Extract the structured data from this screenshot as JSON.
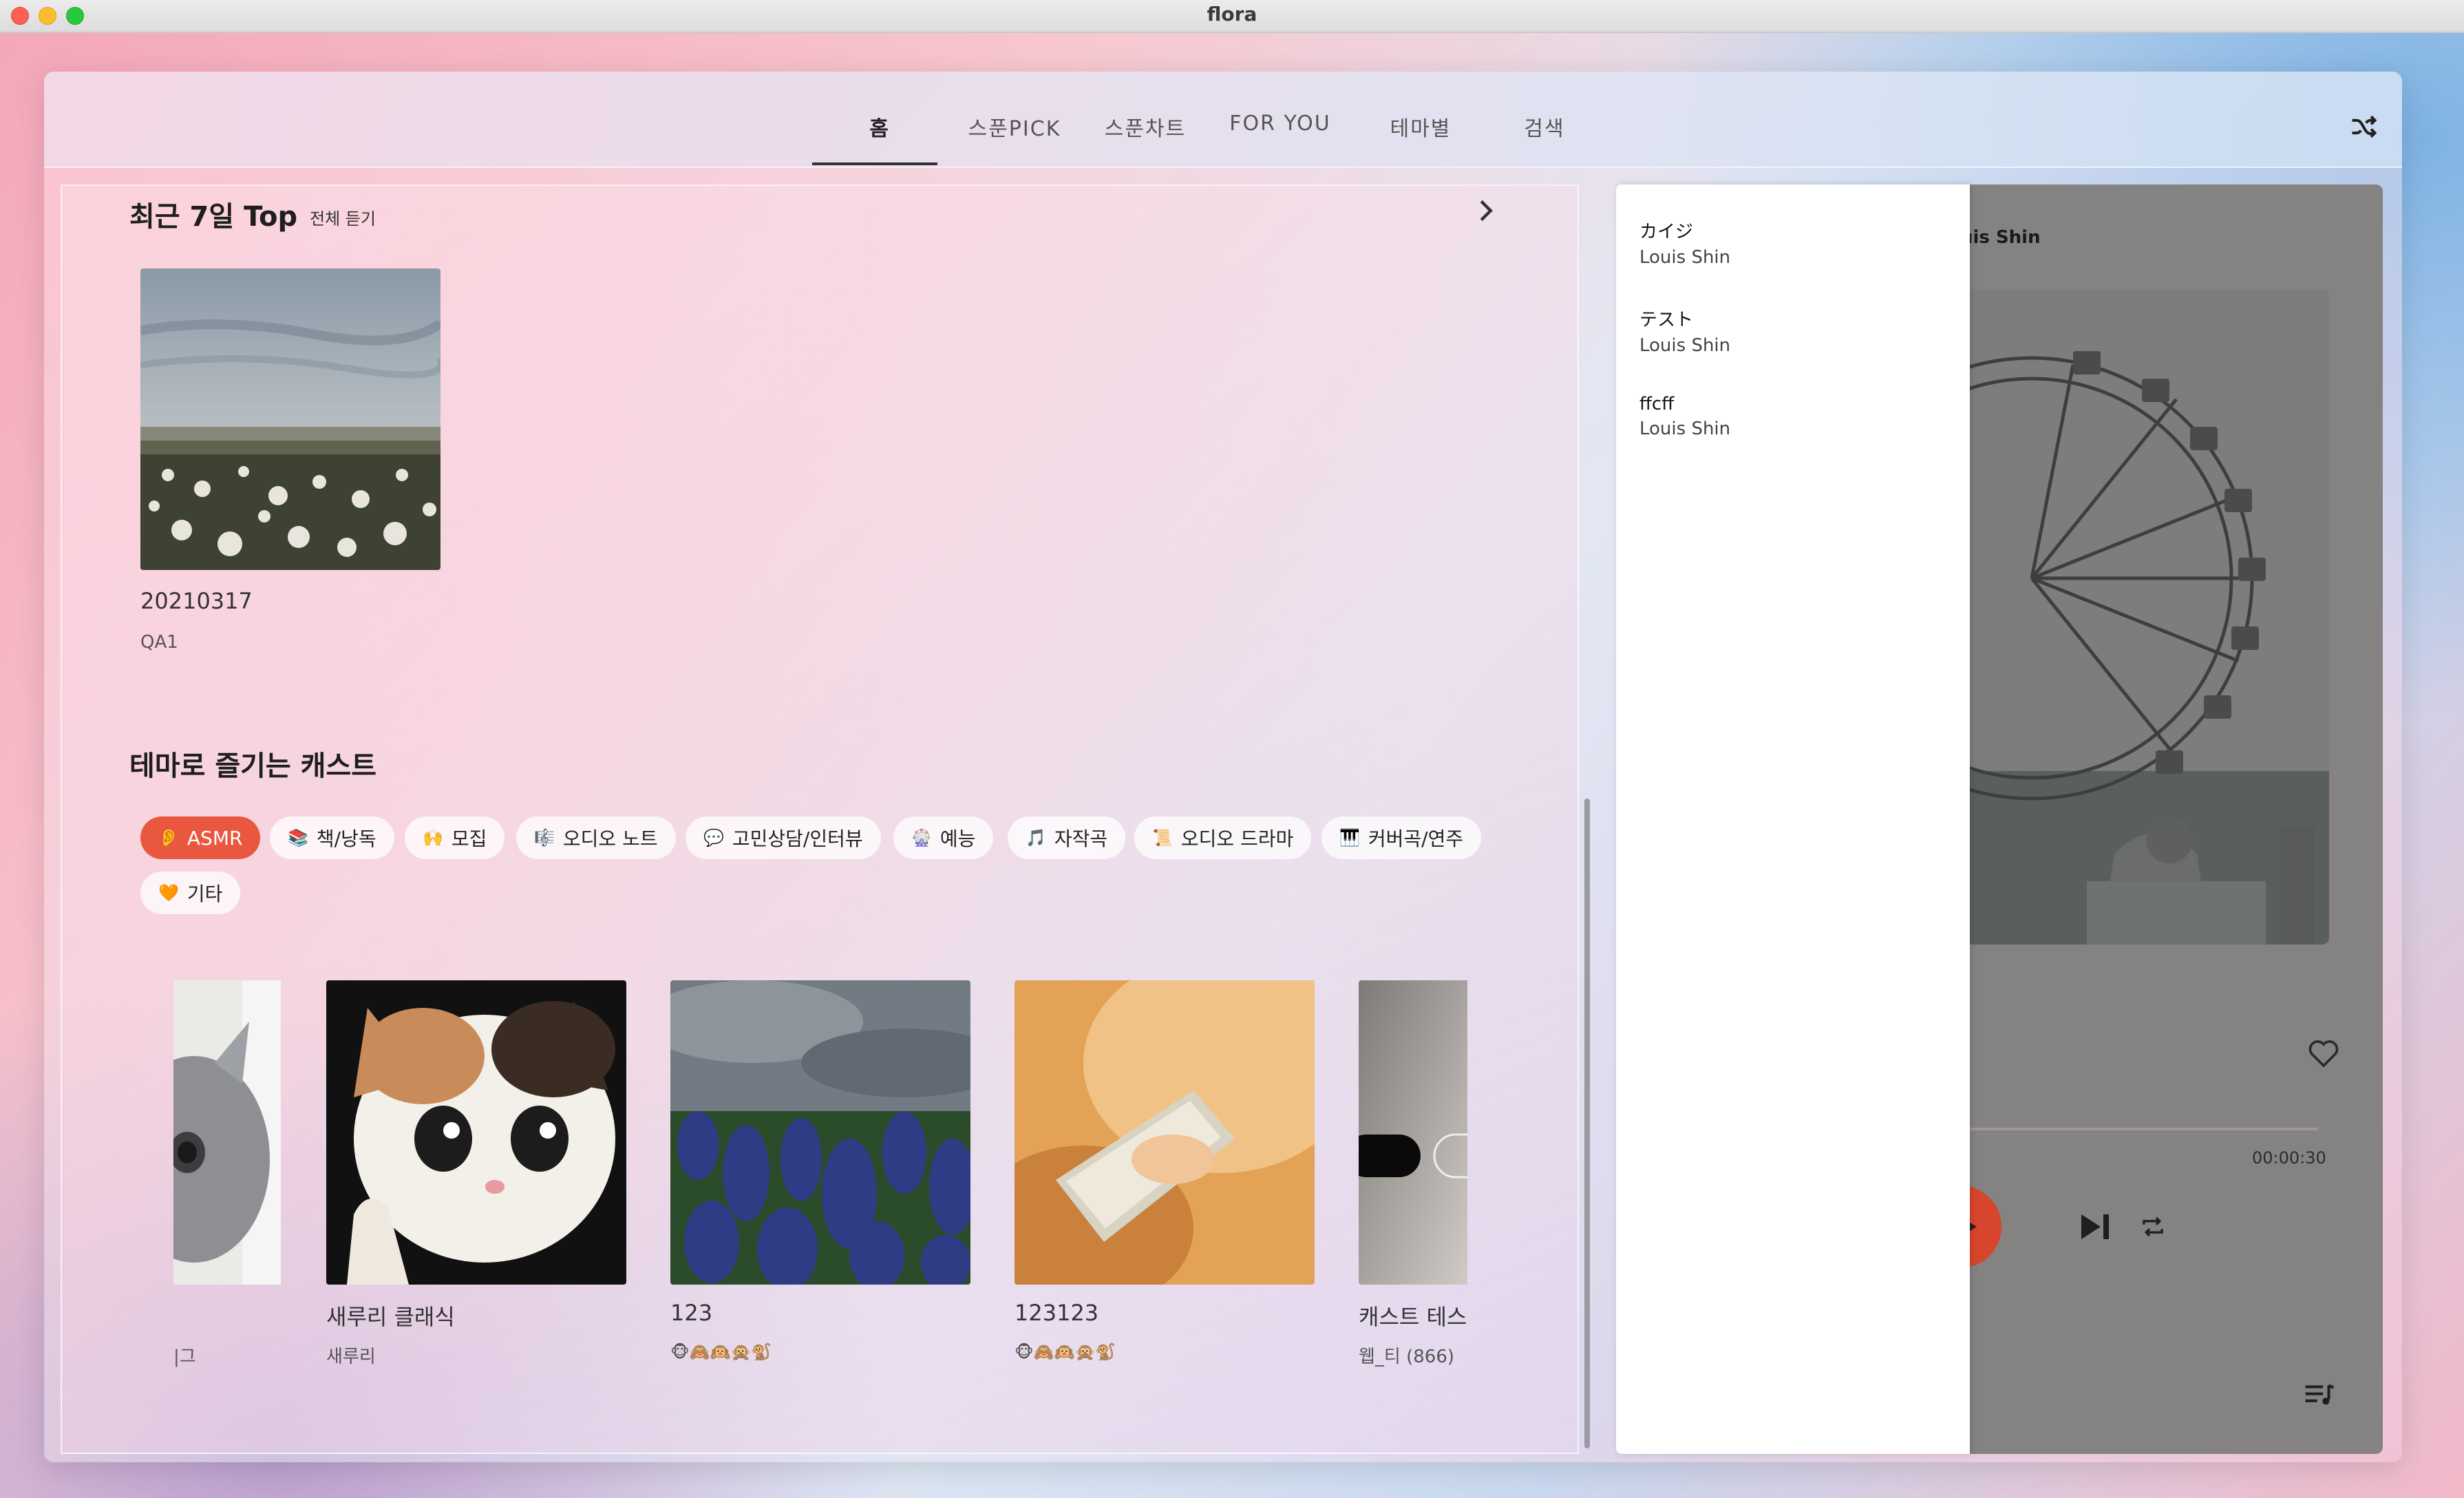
{
  "window": {
    "title": "flora"
  },
  "nav": {
    "tabs": [
      {
        "label": "홈",
        "active": true
      },
      {
        "label": "스푼PICK",
        "active": false
      },
      {
        "label": "스푼차트",
        "active": false
      },
      {
        "label": "FOR YOU",
        "active": false
      },
      {
        "label": "테마별",
        "active": false
      },
      {
        "label": "검색",
        "active": false
      }
    ],
    "shuffle_icon": "shuffle-icon"
  },
  "recent_top": {
    "title": "최근 7일 Top",
    "play_all": "전체 듣기",
    "items": [
      {
        "title": "20210317",
        "subtitle": "QA1"
      }
    ]
  },
  "themes": {
    "title": "테마로 즐기는 캐스트",
    "chips": [
      {
        "emoji": "👂",
        "label": "ASMR",
        "active": true
      },
      {
        "emoji": "📚",
        "label": "책/낭독",
        "active": false
      },
      {
        "emoji": "🙌",
        "label": "모집",
        "active": false
      },
      {
        "emoji": "🎼",
        "label": "오디오 노트",
        "active": false
      },
      {
        "emoji": "💬",
        "label": "고민상담/인터뷰",
        "active": false
      },
      {
        "emoji": "🎡",
        "label": "예능",
        "active": false
      },
      {
        "emoji": "🎵",
        "label": "자작곡",
        "active": false
      },
      {
        "emoji": "📜",
        "label": "오디오 드라마",
        "active": false
      },
      {
        "emoji": "🎹",
        "label": "커버곡/연주",
        "active": false
      },
      {
        "emoji": "🧡",
        "label": "기타",
        "active": false
      }
    ],
    "casts": [
      {
        "title": "",
        "subtitle": "|그"
      },
      {
        "title": "새루리 클래식",
        "subtitle": "새루리"
      },
      {
        "title": "123",
        "subtitle": "🐵🙈🙉🙊🐒"
      },
      {
        "title": "123123",
        "subtitle": "🐵🙈🙉🙊🐒"
      },
      {
        "title": "캐스트 테스",
        "subtitle": "웹_티 (866)"
      }
    ]
  },
  "player": {
    "artist_partial": "uis Shin",
    "time_total": "00:00:30",
    "progress": 0.0,
    "icons": [
      "heart-icon",
      "play-icon",
      "next-icon",
      "repeat-icon",
      "queue-icon"
    ]
  },
  "dropdown": {
    "items": [
      {
        "title": "カイジ",
        "artist": "Louis Shin"
      },
      {
        "title": "テスト",
        "artist": "Louis Shin"
      },
      {
        "title": "ffcff",
        "artist": "Louis Shin"
      }
    ]
  },
  "colors": {
    "accent": "#e9573f",
    "play_button": "#d6452c"
  }
}
